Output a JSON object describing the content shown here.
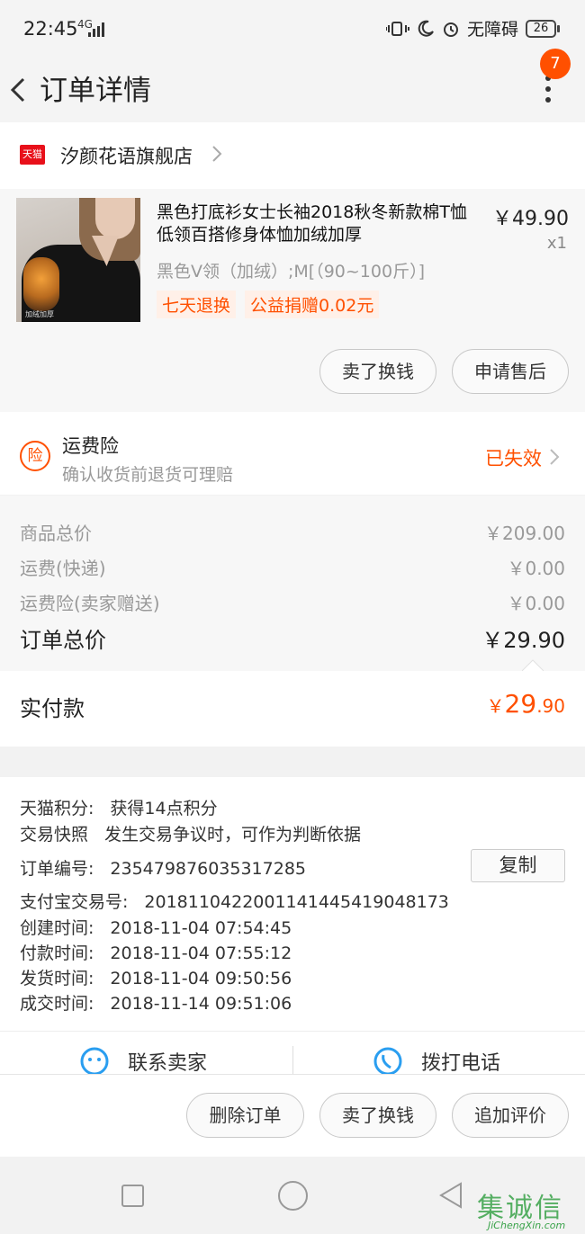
{
  "status_bar": {
    "time": "22:45",
    "network": "4G",
    "accessibility": "无障碍",
    "battery": "26"
  },
  "nav": {
    "title": "订单详情",
    "badge_count": "7"
  },
  "shop": {
    "logo_text": "天猫",
    "name": "汐颜花语旗舰店"
  },
  "product": {
    "title": "黑色打底衫女士长袖2018秋冬新款棉T恤低领百搭修身体恤加绒加厚",
    "price": "￥49.90",
    "quantity": "x1",
    "sku": "黑色V领（加绒）;M[（90~100斤）]",
    "tags": [
      "七天退换",
      "公益捐赠0.02元"
    ],
    "image_caption": "加绒加厚",
    "buttons": [
      "卖了换钱",
      "申请售后"
    ]
  },
  "insurance": {
    "icon_text": "险",
    "title": "运费险",
    "desc": "确认收货前退货可理赔",
    "status": "已失效"
  },
  "price_summary": {
    "rows": [
      {
        "label": "商品总价",
        "value": "￥209.00"
      },
      {
        "label": "运费(快递)",
        "value": "￥0.00"
      },
      {
        "label": "运费险(卖家赠送)",
        "value": "￥0.00"
      }
    ],
    "total_label": "订单总价",
    "total_value": "￥29.90"
  },
  "paid": {
    "label": "实付款",
    "currency": "￥",
    "integer": "29",
    "decimal": ".90"
  },
  "order_info": {
    "lines": [
      {
        "key": "天猫积分:",
        "value": "获得14点积分"
      },
      {
        "key": "交易快照",
        "value": "发生交易争议时，可作为判断依据"
      },
      {
        "key": "订单编号:",
        "value": "235479876035317285"
      },
      {
        "key": "支付宝交易号:",
        "value": "2018110422001141445419048173"
      },
      {
        "key": "创建时间:",
        "value": "2018-11-04 07:54:45"
      },
      {
        "key": "付款时间:",
        "value": "2018-11-04 07:55:12"
      },
      {
        "key": "发货时间:",
        "value": "2018-11-04 09:50:56"
      },
      {
        "key": "成交时间:",
        "value": "2018-11-14 09:51:06"
      }
    ],
    "copy_label": "复制"
  },
  "contact": {
    "seller": "联系卖家",
    "call": "拨打电话"
  },
  "bottom_actions": [
    "删除订单",
    "卖了换钱",
    "追加评价"
  ],
  "watermark": {
    "glyphs": "集诚信",
    "url": "JiChengXin.com"
  },
  "colors": {
    "accent": "#ff5000",
    "tmall_red": "#e8101a",
    "watermark_green": "#3aa34a"
  }
}
